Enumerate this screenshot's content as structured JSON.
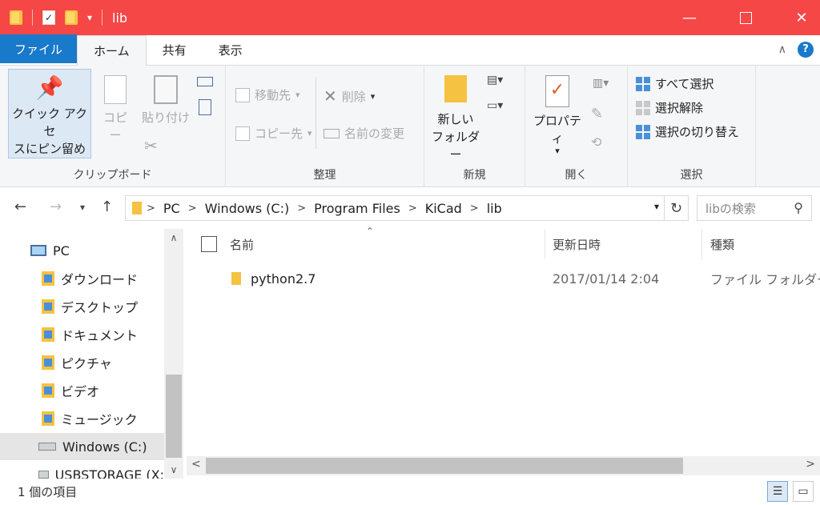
{
  "window": {
    "title": "lib",
    "minimize": "—",
    "close": "✕"
  },
  "tabs": {
    "file": "ファイル",
    "home": "ホーム",
    "share": "共有",
    "view": "表示"
  },
  "ribbon": {
    "clipboard": {
      "pin_line1": "クイック アクセ",
      "pin_line2": "スにピン留め",
      "copy": "コピー",
      "paste": "貼り付け",
      "label": "クリップボード"
    },
    "organize": {
      "move_to": "移動先",
      "copy_to": "コピー先",
      "delete": "削除",
      "rename": "名前の変更",
      "label": "整理"
    },
    "new": {
      "new_folder_line1": "新しい",
      "new_folder_line2": "フォルダー",
      "label": "新規"
    },
    "open": {
      "properties": "プロパティ",
      "label": "開く"
    },
    "select": {
      "select_all": "すべて選択",
      "select_none": "選択解除",
      "invert": "選択の切り替え",
      "label": "選択"
    }
  },
  "address": {
    "crumbs": [
      "PC",
      "Windows (C:)",
      "Program Files",
      "KiCad",
      "lib"
    ],
    "search_placeholder": "libの検索"
  },
  "navpane": {
    "items": [
      {
        "label": "PC"
      },
      {
        "label": "ダウンロード"
      },
      {
        "label": "デスクトップ"
      },
      {
        "label": "ドキュメント"
      },
      {
        "label": "ピクチャ"
      },
      {
        "label": "ビデオ"
      },
      {
        "label": "ミュージック"
      },
      {
        "label": "Windows (C:)"
      },
      {
        "label": "USBSTORAGE (X:"
      }
    ]
  },
  "files": {
    "columns": {
      "name": "名前",
      "modified": "更新日時",
      "type": "種類"
    },
    "rows": [
      {
        "name": "python2.7",
        "modified": "2017/01/14 2:04",
        "type": "ファイル フォルダー"
      }
    ]
  },
  "status": {
    "count": "1 個の項目"
  },
  "colors": {
    "titlebar": "#f64747",
    "file_tab": "#1979ca"
  }
}
